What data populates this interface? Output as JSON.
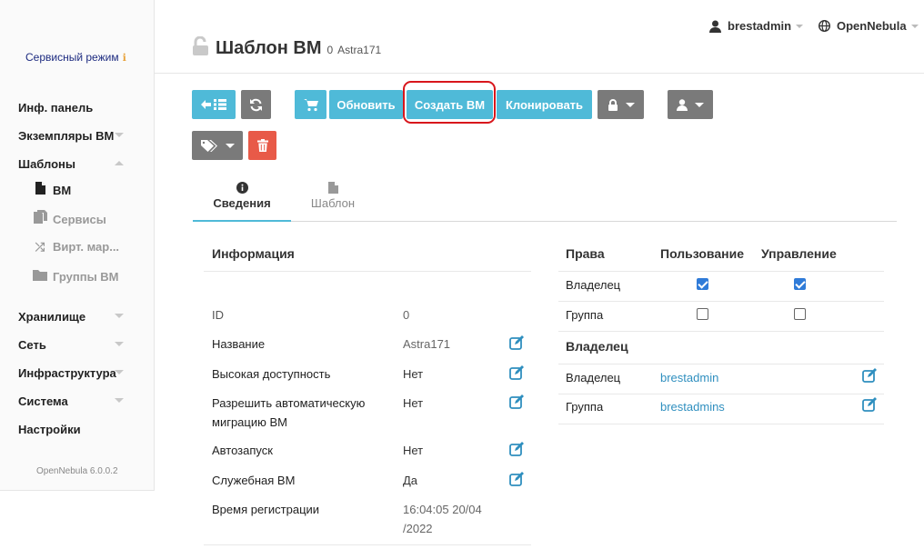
{
  "sidebar": {
    "service_mode": "Сервисный режим",
    "items": [
      {
        "label": "Инф. панель"
      },
      {
        "label": "Экземпляры ВМ"
      },
      {
        "label": "Шаблоны"
      },
      {
        "label": "Хранилище"
      },
      {
        "label": "Сеть"
      },
      {
        "label": "Инфраструктура"
      },
      {
        "label": "Система"
      },
      {
        "label": "Настройки"
      }
    ],
    "sub_items": [
      {
        "label": "ВМ",
        "icon": "file-icon",
        "active": true
      },
      {
        "label": "Сервисы",
        "icon": "files-icon"
      },
      {
        "label": "Вирт. мар...",
        "icon": "shuffle-icon"
      },
      {
        "label": "Группы ВМ",
        "icon": "folder-icon"
      }
    ],
    "version": "OpenNebula 6.0.0.2"
  },
  "header": {
    "title": "Шаблон ВМ",
    "template_id": "0",
    "template_name": "Astra171",
    "user": "brestadmin",
    "zone": "OpenNebula"
  },
  "toolbar": {
    "update": "Обновить",
    "create_vm": "Создать ВМ",
    "clone": "Клонировать",
    "accent_color": "#4fbad8",
    "highlight_color": "#d8161c"
  },
  "tabs": [
    {
      "label": "Сведения",
      "icon": "info-icon",
      "active": true
    },
    {
      "label": "Шаблон",
      "icon": "file-icon"
    }
  ],
  "info": {
    "heading": "Информация",
    "rows": [
      {
        "label": "ID",
        "value": "0"
      },
      {
        "label": "Название",
        "value": "Astra171"
      },
      {
        "label": "Высокая доступность",
        "value": "Нет"
      },
      {
        "label": "Разрешить автоматическую миграцию ВМ",
        "value": "Нет"
      },
      {
        "label": "Автозапуск",
        "value": "Нет"
      },
      {
        "label": "Служебная ВМ",
        "value": "Да"
      },
      {
        "label": "Время регистрации",
        "value": "16:04:05 20/04 /2022"
      }
    ]
  },
  "permissions": {
    "heading": "Права",
    "col_use": "Пользование",
    "col_manage": "Управление",
    "rows": [
      {
        "label": "Владелец",
        "use": true,
        "manage": true
      },
      {
        "label": "Группа",
        "use": false,
        "manage": false
      }
    ]
  },
  "ownership": {
    "heading": "Владелец",
    "owner_label": "Владелец",
    "owner_value": "brestadmin",
    "group_label": "Группа",
    "group_value": "brestadmins"
  }
}
